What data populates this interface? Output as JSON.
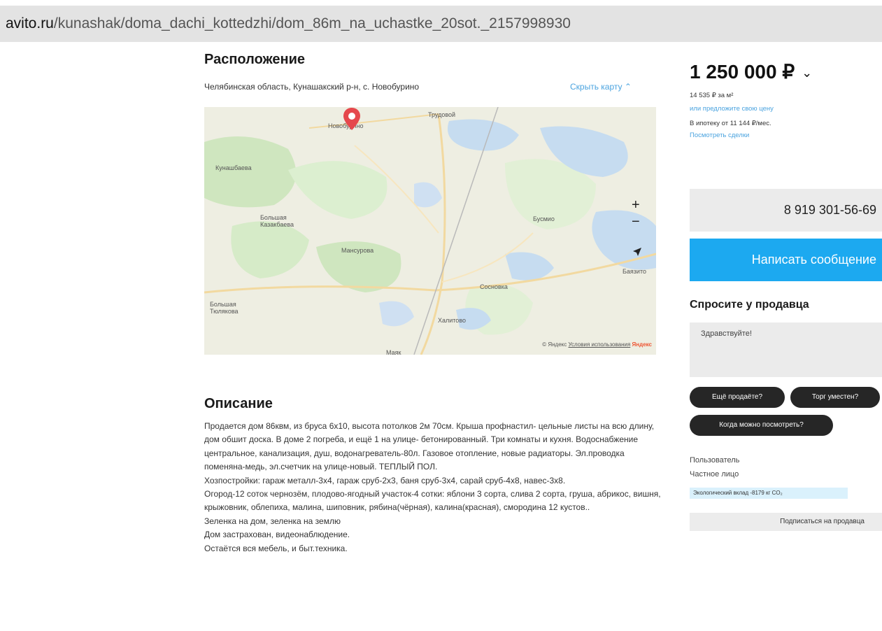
{
  "browser": {
    "url_domain": "avito.ru",
    "url_path": "/kunashak/doma_dachi_kottedzhi/dom_86m_na_uchastke_20sot._2157998930"
  },
  "location": {
    "title": "Расположение",
    "address": "Челябинская область, Кунашакский р-н, с. Новобурино",
    "hide_map_label": "Скрыть карту",
    "hide_map_icon": "chevron-up-icon",
    "map": {
      "labels": [
        "Новобурино",
        "Трудовой",
        "Кунашбаева",
        "Большая Казакбаева",
        "Мансурова",
        "Бусмио",
        "Баязито",
        "Сосновка",
        "Большая Тюлякова",
        "Халитово",
        "Маяк"
      ],
      "attribution_copyright": "© Яндекс",
      "attribution_terms": "Условия использования",
      "attribution_brand": "Яндекс",
      "zoom_in": "+",
      "zoom_out": "−",
      "locate_icon": "navigation-arrow-icon",
      "pin_icon": "map-pin-icon"
    }
  },
  "description": {
    "title": "Описание",
    "paragraphs": [
      "Продается дом 86квм, из бруса 6х10, высота потолков 2м 70см. Крыша профнастил- цельные листы на всю длину, дом обшит доска. В доме 2 погреба, и ещё 1 на улице- бетонированный. Три комнаты и кухня. Водоснабжение центральное, канализация, душ, водонагреватель-80л. Газовое отопление, новые радиаторы. Эл.проводка поменяна-медь, эл.счетчик на улице-новый. ТЕПЛЫЙ ПОЛ.",
      "Хозпостройки: гараж металл-3х4, гараж сруб-2х3, баня сруб-3х4, сарай сруб-4х8, навес-3х8.",
      "Огород-12 соток чернозём, плодово-ягодный участок-4 сотки: яблони 3 сорта, слива 2 сорта, груша, абрикос, вишня, крыжовник, облепиха, малина, шиповник, рябина(чёрная), калина(красная), смородина 12 кустов..",
      "Зеленка на дом, зеленка на землю",
      "Дом застрахован, видеонаблюдение.",
      "Остаётся вся мебель, и быт.техника."
    ]
  },
  "sidebar": {
    "price": "1 250 000 ₽",
    "price_toggle_icon": "chevron-down-icon",
    "price_per_m2": "14 535 ₽ за м²",
    "offer_price_link": "или предложите свою цену",
    "mortgage": "В ипотеку от 11 144 ₽/мес.",
    "offers_link": "Посмотреть сделки",
    "phone": "8 919 301-56-69",
    "message_button": "Написать сообщение",
    "ask_title": "Спросите у продавца",
    "ask_input_value": "Здравствуйте!",
    "quick_questions": [
      "Ещё продаёте?",
      "Торг уместен?",
      "Когда можно посмотреть?"
    ],
    "seller_name": "Пользователь",
    "seller_type": "Частное лицо",
    "eco_badge": "Экологический вклад -8179 кг CO₂",
    "subscribe_button": "Подписаться на продавца"
  },
  "colors": {
    "accent": "#1ca9f0",
    "link": "#4aa3df",
    "map_pin": "#e5484d",
    "chip_bg": "#262626"
  }
}
